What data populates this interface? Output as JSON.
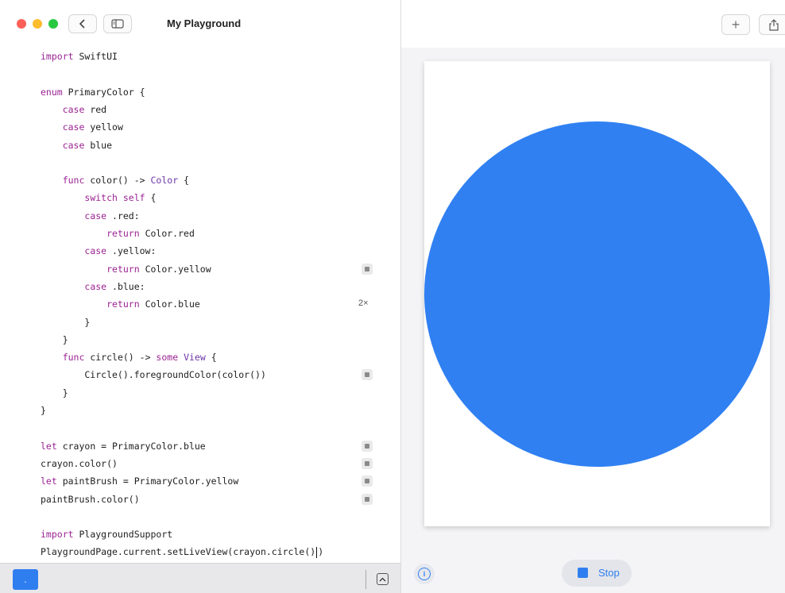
{
  "window": {
    "title": "My Playground"
  },
  "toolbar": {
    "back_icon": "chevron-left-icon",
    "sidebar_icon": "sidebar-icon",
    "add_label": "+",
    "share_icon": "share-icon"
  },
  "editor": {
    "lines": [
      [
        {
          "t": "import",
          "c": "kw"
        },
        {
          "t": " SwiftUI"
        }
      ],
      [],
      [
        {
          "t": "enum",
          "c": "kw"
        },
        {
          "t": " PrimaryColor {"
        }
      ],
      [
        {
          "t": "    "
        },
        {
          "t": "case",
          "c": "kw"
        },
        {
          "t": " red"
        }
      ],
      [
        {
          "t": "    "
        },
        {
          "t": "case",
          "c": "kw"
        },
        {
          "t": " yellow"
        }
      ],
      [
        {
          "t": "    "
        },
        {
          "t": "case",
          "c": "kw"
        },
        {
          "t": " blue"
        }
      ],
      [],
      [
        {
          "t": "    "
        },
        {
          "t": "func",
          "c": "kw"
        },
        {
          "t": " color() -> "
        },
        {
          "t": "Color",
          "c": "ty"
        },
        {
          "t": " {"
        }
      ],
      [
        {
          "t": "        "
        },
        {
          "t": "switch",
          "c": "kw"
        },
        {
          "t": " "
        },
        {
          "t": "self",
          "c": "kw"
        },
        {
          "t": " {"
        }
      ],
      [
        {
          "t": "        "
        },
        {
          "t": "case",
          "c": "kw"
        },
        {
          "t": " .red:"
        }
      ],
      [
        {
          "t": "            "
        },
        {
          "t": "return",
          "c": "kw"
        },
        {
          "t": " Color.red"
        }
      ],
      [
        {
          "t": "        "
        },
        {
          "t": "case",
          "c": "kw"
        },
        {
          "t": " .yellow:"
        }
      ],
      [
        {
          "t": "            "
        },
        {
          "t": "return",
          "c": "kw"
        },
        {
          "t": " Color.yellow"
        }
      ],
      [
        {
          "t": "        "
        },
        {
          "t": "case",
          "c": "kw"
        },
        {
          "t": " .blue:"
        }
      ],
      [
        {
          "t": "            "
        },
        {
          "t": "return",
          "c": "kw"
        },
        {
          "t": " Color.blue"
        }
      ],
      [
        {
          "t": "        }"
        }
      ],
      [
        {
          "t": "    }"
        }
      ],
      [
        {
          "t": "    "
        },
        {
          "t": "func",
          "c": "kw"
        },
        {
          "t": " circle() -> "
        },
        {
          "t": "some",
          "c": "kw"
        },
        {
          "t": " "
        },
        {
          "t": "View",
          "c": "ty"
        },
        {
          "t": " {"
        }
      ],
      [
        {
          "t": "        Circle().foregroundColor(color())"
        }
      ],
      [
        {
          "t": "    }"
        }
      ],
      [
        {
          "t": "}"
        }
      ],
      [],
      [
        {
          "t": "let",
          "c": "kw"
        },
        {
          "t": " crayon = PrimaryColor.blue"
        }
      ],
      [
        {
          "t": "crayon.color()"
        }
      ],
      [
        {
          "t": "let",
          "c": "kw"
        },
        {
          "t": " paintBrush = PrimaryColor.yellow"
        }
      ],
      [
        {
          "t": "paintBrush.color()"
        }
      ],
      [],
      [
        {
          "t": "import",
          "c": "kw"
        },
        {
          "t": " PlaygroundSupport"
        }
      ],
      [
        {
          "t": "PlaygroundPage.current.setLiveView(crayon.circle()"
        },
        {
          "t": "|CURSOR|"
        },
        {
          "t": ")"
        }
      ]
    ],
    "result_markers": [
      {
        "line": 12,
        "kind": "icon"
      },
      {
        "line": 14,
        "kind": "text",
        "text": "2×"
      },
      {
        "line": 18,
        "kind": "icon"
      },
      {
        "line": 22,
        "kind": "icon"
      },
      {
        "line": 23,
        "kind": "icon"
      },
      {
        "line": 24,
        "kind": "icon"
      },
      {
        "line": 25,
        "kind": "icon"
      }
    ]
  },
  "bottombar": {
    "run_label": ".",
    "run_icon": "run-icon",
    "expand_icon": "expand-icon"
  },
  "liveview": {
    "circle_color": "#3080f2",
    "info_label": "i",
    "stop_label": "Stop"
  }
}
